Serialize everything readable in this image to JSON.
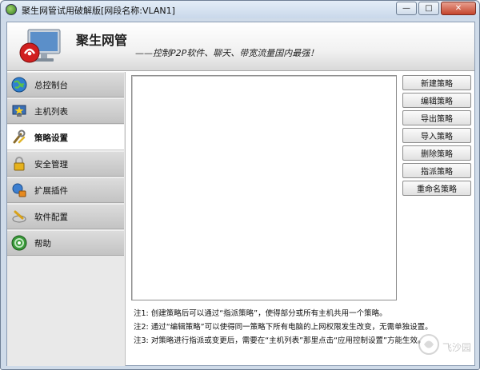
{
  "window": {
    "title": "聚生网管试用破解版[网段名称:VLAN1]",
    "minimize": "—",
    "maximize": "□",
    "close": "✕"
  },
  "banner": {
    "brand": "聚生网管",
    "slogan": "——控制P2P软件、聊天、带宽流量国内最强！"
  },
  "sidebar": {
    "items": [
      {
        "label": "总控制台",
        "icon": "globe-icon",
        "active": false
      },
      {
        "label": "主机列表",
        "icon": "monitor-star-icon",
        "active": false
      },
      {
        "label": "策略设置",
        "icon": "tools-icon",
        "active": true
      },
      {
        "label": "安全管理",
        "icon": "lock-icon",
        "active": false
      },
      {
        "label": "扩展插件",
        "icon": "plugin-icon",
        "active": false
      },
      {
        "label": "软件配置",
        "icon": "wrench-disc-icon",
        "active": false
      },
      {
        "label": "帮助",
        "icon": "help-globe-icon",
        "active": false
      }
    ]
  },
  "actions": {
    "buttons": [
      "新建策略",
      "编辑策略",
      "导出策略",
      "导入策略",
      "删除策略",
      "指派策略",
      "重命名策略"
    ]
  },
  "notes": [
    "注1: 创建策略后可以通过“指派策略”，使得部分或所有主机共用一个策略。",
    "注2: 通过“编辑策略”可以使得同一策略下所有电脑的上网权限发生改变，无需单独设置。",
    "注3: 对策略进行指派或变更后，需要在“主机列表”那里点击“应用控制设置”方能生效。"
  ],
  "watermark": {
    "text": "飞沙园"
  }
}
